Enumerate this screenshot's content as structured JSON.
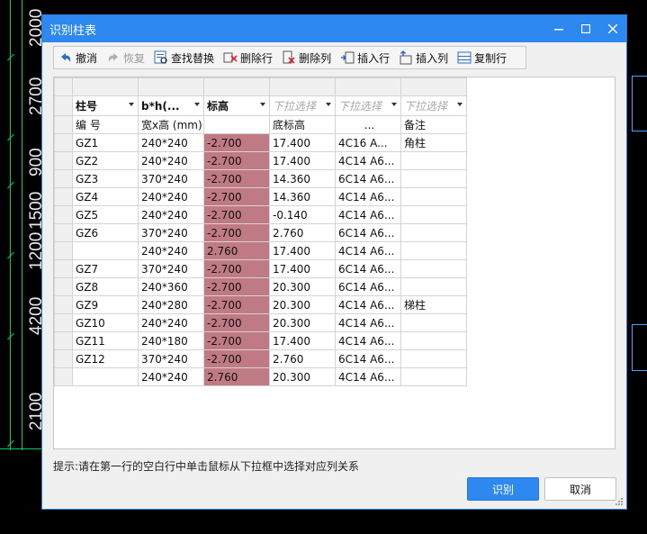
{
  "cad": {
    "dimensions": [
      "2000",
      "2700",
      "900",
      "1500",
      "1200",
      "4200",
      "2100"
    ]
  },
  "dialog": {
    "title": "识别柱表",
    "window_buttons": {
      "minimize": "—",
      "maximize": "☐",
      "close": "✕"
    },
    "toolbar": {
      "undo": "撤消",
      "redo": "恢复",
      "find_replace": "查找替换",
      "delete_row": "删除行",
      "delete_col": "删除列",
      "insert_row": "插入行",
      "insert_col": "插入列",
      "copy_row": "复制行"
    },
    "table": {
      "selectors": [
        "柱号",
        "b*h(...",
        "标高",
        "下拉选择",
        "下拉选择",
        "下拉选择"
      ],
      "header": [
        "编 号",
        "宽x高 (mm)",
        "",
        "底标高",
        "...",
        "备注"
      ],
      "rows": [
        [
          "GZ1",
          "240*240",
          "-2.700",
          "17.400",
          "4C16  A...",
          "角柱"
        ],
        [
          "GZ2",
          "240*240",
          "-2.700",
          "17.400",
          "4C14  A6...",
          ""
        ],
        [
          "GZ3",
          "370*240",
          "-2.700",
          "14.360",
          "6C14  A6...",
          ""
        ],
        [
          "GZ4",
          "240*240",
          "-2.700",
          "14.360",
          "4C14  A6...",
          ""
        ],
        [
          "GZ5",
          "240*240",
          "-2.700",
          "-0.140",
          "4C14  A6...",
          ""
        ],
        [
          "GZ6",
          "370*240",
          "-2.700",
          "2.760",
          "6C14  A6...",
          ""
        ],
        [
          "",
          "240*240",
          "2.760",
          "17.400",
          "4C14  A6...",
          ""
        ],
        [
          "GZ7",
          "370*240",
          "-2.700",
          "17.400",
          "6C14  A6...",
          ""
        ],
        [
          "GZ8",
          "240*360",
          "-2.700",
          "20.300",
          "6C14  A6...",
          ""
        ],
        [
          "GZ9",
          "240*280",
          "-2.700",
          "20.300",
          "4C14  A6...",
          "梯柱"
        ],
        [
          "GZ10",
          "240*240",
          "-2.700",
          "20.300",
          "4C14  A6...",
          ""
        ],
        [
          "GZ11",
          "240*180",
          "-2.700",
          "17.400",
          "4C14  A6...",
          ""
        ],
        [
          "GZ12",
          "370*240",
          "-2.700",
          "2.760",
          "6C14  A6...",
          ""
        ],
        [
          "",
          "240*240",
          "2.760",
          "20.300",
          "4C14  A6...",
          ""
        ]
      ]
    },
    "hint": "提示:请在第一行的空白行中单击鼠标从下拉框中选择对应列关系",
    "buttons": {
      "ok": "识别",
      "cancel": "取消"
    },
    "colors": {
      "accent": "#2d89ef",
      "highlight": "#c07a84"
    }
  }
}
